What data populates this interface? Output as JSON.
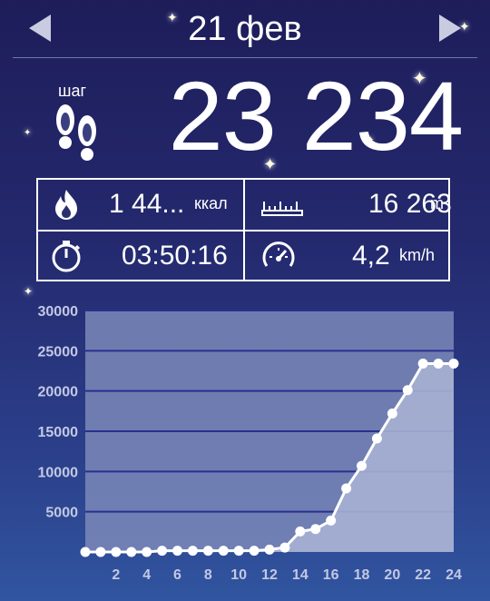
{
  "header": {
    "date": "21 фев",
    "prev_icon": "arrow-left-icon",
    "next_icon": "arrow-right-icon"
  },
  "steps": {
    "label": "шаг",
    "value": "23 234",
    "icon": "footprints-icon"
  },
  "stats": {
    "calories": {
      "value": "1 44...",
      "unit": "ккал",
      "icon": "flame-icon"
    },
    "distance": {
      "value": "16 263",
      "unit": "m",
      "icon": "ruler-icon"
    },
    "duration": {
      "value": "03:50:16",
      "icon": "stopwatch-icon"
    },
    "speed": {
      "value": "4,2",
      "unit": "km/h",
      "icon": "speedometer-icon"
    }
  },
  "colors": {
    "accent": "#ffffff",
    "grid": "#2a2f8f",
    "plot_bg": "#7b88b8",
    "area_fill": "#a7b1d3"
  },
  "chart_data": {
    "type": "area",
    "title": "",
    "xlabel": "",
    "ylabel": "",
    "x": [
      0,
      1,
      2,
      3,
      4,
      5,
      6,
      7,
      8,
      9,
      10,
      11,
      12,
      13,
      14,
      15,
      16,
      17,
      18,
      19,
      20,
      21,
      22,
      23,
      24
    ],
    "values": [
      0,
      0,
      0,
      0,
      0,
      150,
      150,
      150,
      150,
      150,
      150,
      150,
      300,
      550,
      2550,
      2850,
      3900,
      7900,
      10700,
      14100,
      17200,
      20100,
      23400,
      23400,
      23400
    ],
    "xticks": [
      "2",
      "4",
      "6",
      "8",
      "10",
      "12",
      "14",
      "16",
      "18",
      "20",
      "22",
      "24"
    ],
    "yticks": [
      "5000",
      "10000",
      "15000",
      "20000",
      "25000",
      "30000"
    ],
    "xlim": [
      0,
      24
    ],
    "ylim": [
      0,
      30000
    ],
    "grid": true
  }
}
